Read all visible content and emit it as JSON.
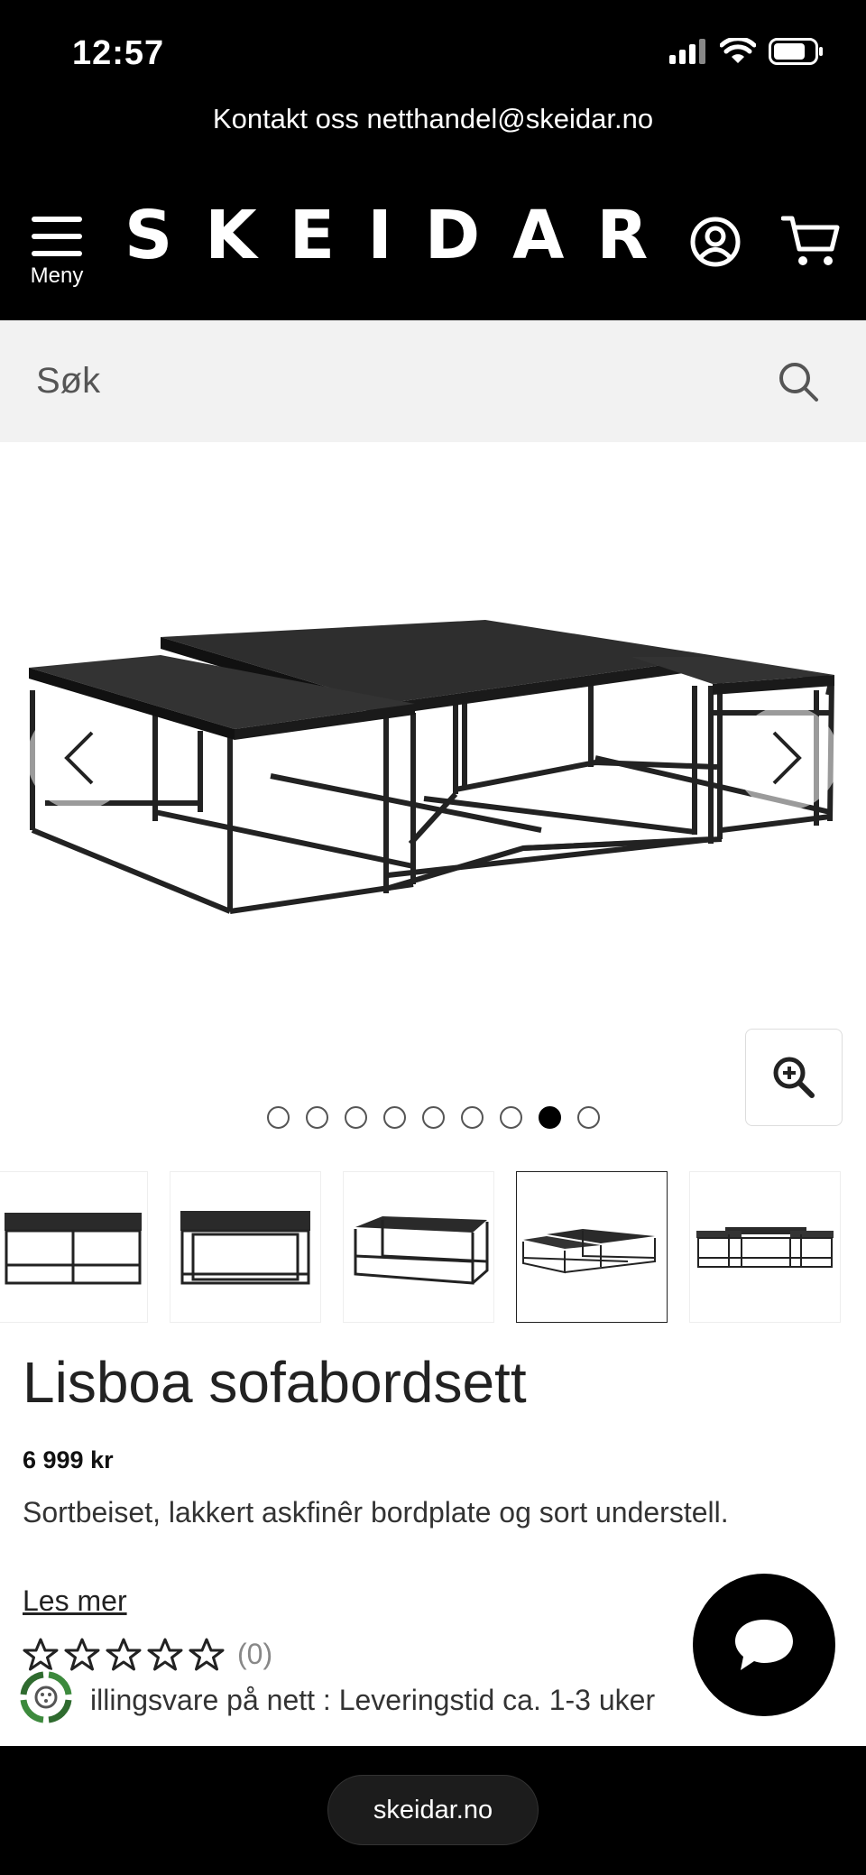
{
  "status": {
    "time": "12:57"
  },
  "header": {
    "contact_text": "Kontakt oss netthandel@skeidar.no",
    "menu_label": "Meny",
    "logo_text": "SKEIDAR"
  },
  "search": {
    "placeholder": "Søk"
  },
  "gallery": {
    "image_count": 9,
    "active_index": 7
  },
  "product": {
    "title": "Lisboa sofabordsett",
    "price": "6 999 kr",
    "description": "Sortbeiset, lakkert askfinêr bordplate og sort understell.",
    "read_more": "Les mer",
    "rating_count": "(0)",
    "rating_stars": 0,
    "delivery": "illingsvare på nett : Leveringstid ca. 1-3 uker"
  },
  "browser": {
    "url": "skeidar.no"
  },
  "colors": {
    "header_bg": "#000000",
    "search_bg": "#f2f2f2"
  }
}
